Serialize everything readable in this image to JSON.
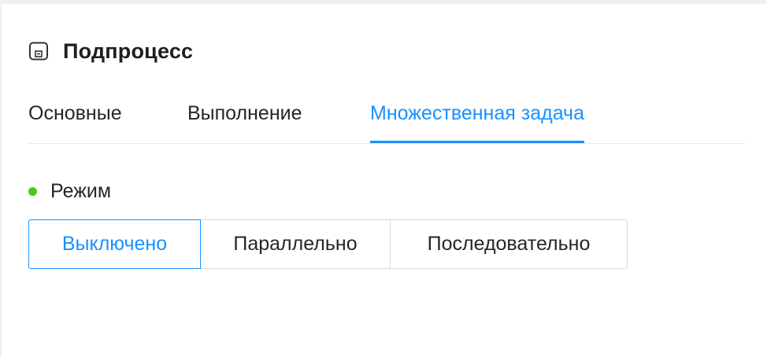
{
  "header": {
    "icon": "subprocess-icon",
    "title": "Подпроцесс"
  },
  "tabs": [
    {
      "label": "Основные",
      "active": false
    },
    {
      "label": "Выполнение",
      "active": false
    },
    {
      "label": "Множественная задача",
      "active": true
    }
  ],
  "mode": {
    "label": "Режим",
    "indicator_color": "#52c41a",
    "selected": "Выключено",
    "options": [
      {
        "label": "Выключено",
        "active": true
      },
      {
        "label": "Параллельно",
        "active": false
      },
      {
        "label": "Последовательно",
        "active": false
      }
    ]
  },
  "colors": {
    "accent": "#1890ff",
    "text": "#262626",
    "border": "#d9d9d9"
  }
}
